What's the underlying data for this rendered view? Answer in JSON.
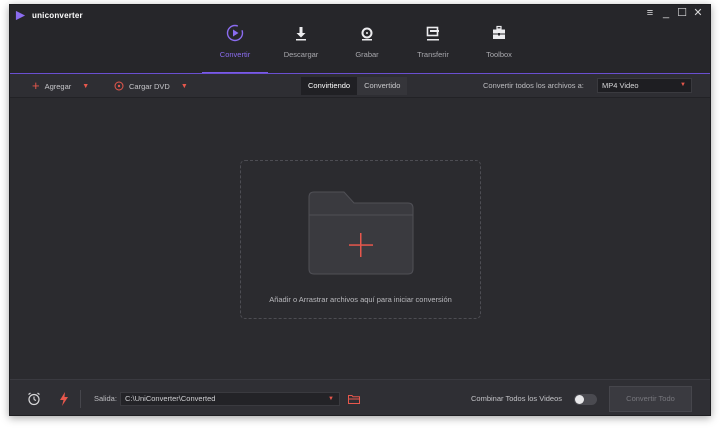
{
  "app": {
    "name": "uniconverter"
  },
  "window_controls": [
    "menu-icon",
    "minimize-icon",
    "maximize-icon",
    "close-icon"
  ],
  "nav": {
    "items": [
      {
        "label": "Convertir",
        "icon": "convert-icon",
        "active": true
      },
      {
        "label": "Descargar",
        "icon": "download-icon",
        "active": false
      },
      {
        "label": "Grabar",
        "icon": "burn-disc-icon",
        "active": false
      },
      {
        "label": "Transferir",
        "icon": "transfer-icon",
        "active": false
      },
      {
        "label": "Toolbox",
        "icon": "toolbox-icon",
        "active": false
      }
    ]
  },
  "toolbar": {
    "add_label": "Agregar",
    "load_dvd_label": "Cargar DVD",
    "tabs": [
      {
        "label": "Convirtiendo",
        "active": true
      },
      {
        "label": "Convertido",
        "active": false
      }
    ],
    "convert_all_label": "Convertir todos los archivos a:",
    "format_value": "MP4 Video"
  },
  "dropzone": {
    "text": "Añadir o Arrastrar archivos aquí para iniciar conversión"
  },
  "footer": {
    "output_label": "Salida:",
    "output_path": "C:\\UniConverter\\Converted",
    "merge_label": "Combinar Todos los Videos",
    "merge_enabled": false,
    "convert_all_button": "Convertir Todo"
  },
  "colors": {
    "accent": "#7b5be6",
    "action_red": "#e7574c",
    "background": "#2b2b2f"
  }
}
